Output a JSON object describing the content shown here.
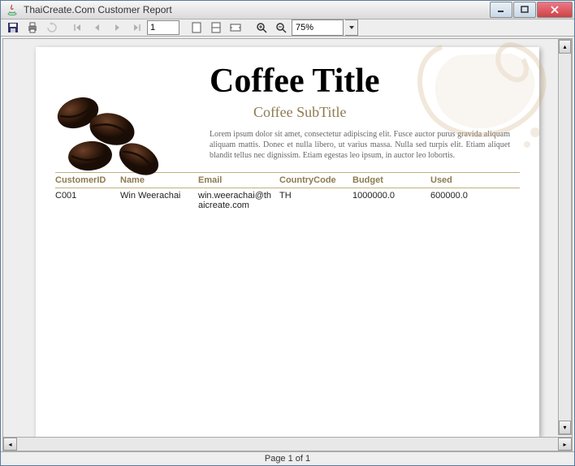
{
  "window": {
    "title": "ThaiCreate.Com Customer Report"
  },
  "toolbar": {
    "page_input": "1",
    "zoom_value": "75%"
  },
  "report": {
    "title": "Coffee Title",
    "subtitle": "Coffee SubTitle",
    "body": "Lorem ipsum dolor sit amet, consectetur adipiscing elit. Fusce auctor purus gravida aliquam aliquam mattis. Donec et nulla libero, ut varius massa. Nulla sed turpis elit. Etiam aliquet blandit tellus nec dignissim. Etiam egestas leo ipsum, in auctor leo lobortis.",
    "columns": [
      "CustomerID",
      "Name",
      "Email",
      "CountryCode",
      "Budget",
      "Used"
    ],
    "rows": [
      {
        "c1": "C001",
        "c2": "Win Weerachai",
        "c3": "win.weerachai@thaicreate.com",
        "c4": "TH",
        "c5": "1000000.0",
        "c6": "600000.0"
      }
    ]
  },
  "status": {
    "page_label": "Page 1 of 1"
  }
}
